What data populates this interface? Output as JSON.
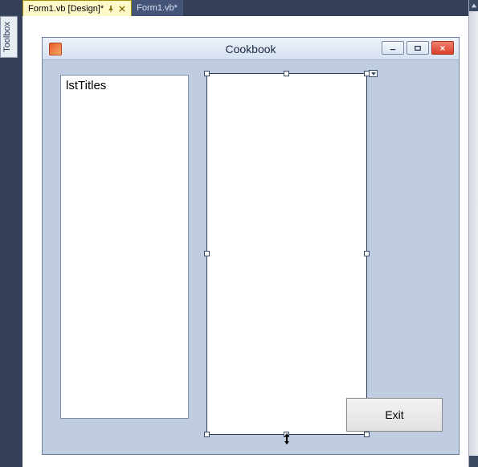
{
  "tabs": [
    {
      "label": "Form1.vb [Design]*",
      "active": true
    },
    {
      "label": "Form1.vb*",
      "active": false
    }
  ],
  "toolbox": {
    "label": "Toolbox"
  },
  "form": {
    "title": "Cookbook",
    "controls": {
      "listbox_text": "lstTitles",
      "exit_label": "Exit"
    },
    "window_buttons": {
      "minimize": "Minimize",
      "maximize": "Maximize",
      "close": "Close"
    }
  }
}
